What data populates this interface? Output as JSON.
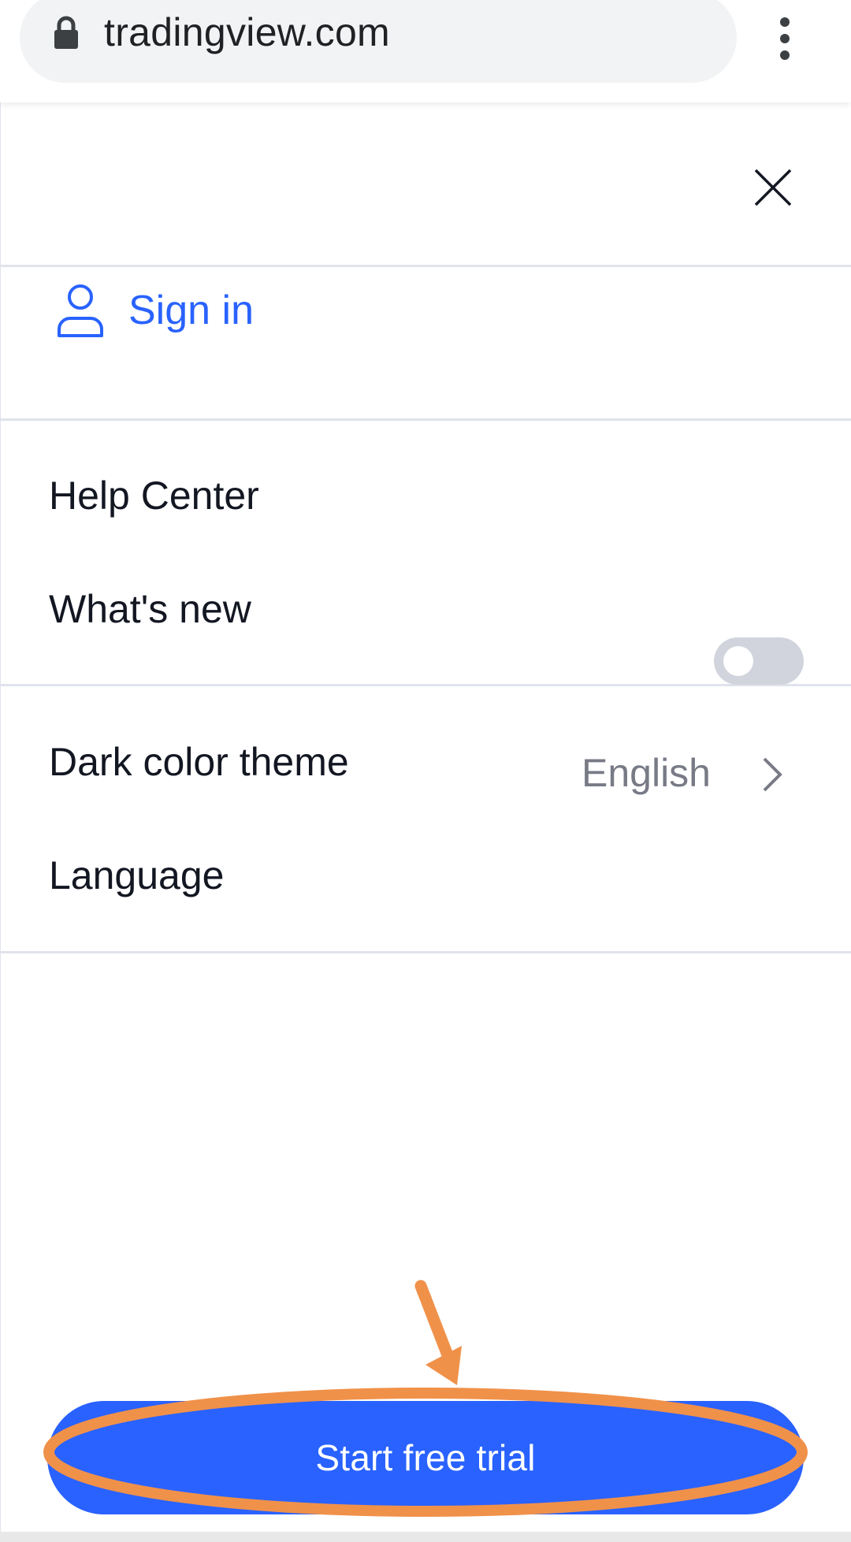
{
  "browser": {
    "url": "tradingview.com",
    "lock_icon": "lock-icon",
    "menu_icon": "kebab-icon"
  },
  "menu": {
    "close_icon": "close-icon",
    "sign_in": {
      "icon": "user-icon",
      "label": "Sign in"
    },
    "links": [
      {
        "label": "Help Center"
      },
      {
        "label": "What's new"
      }
    ],
    "dark_theme": {
      "label": "Dark color theme",
      "enabled": false
    },
    "language": {
      "label": "Language",
      "value": "English",
      "icon": "chevron-right-icon"
    }
  },
  "cta": {
    "label": "Start free trial"
  },
  "colors": {
    "accent": "#2962ff",
    "text": "#131722",
    "muted": "#787b86",
    "divider": "#e0e3eb",
    "toggle_off": "#d1d4dc",
    "annotation": "#f0914a"
  }
}
